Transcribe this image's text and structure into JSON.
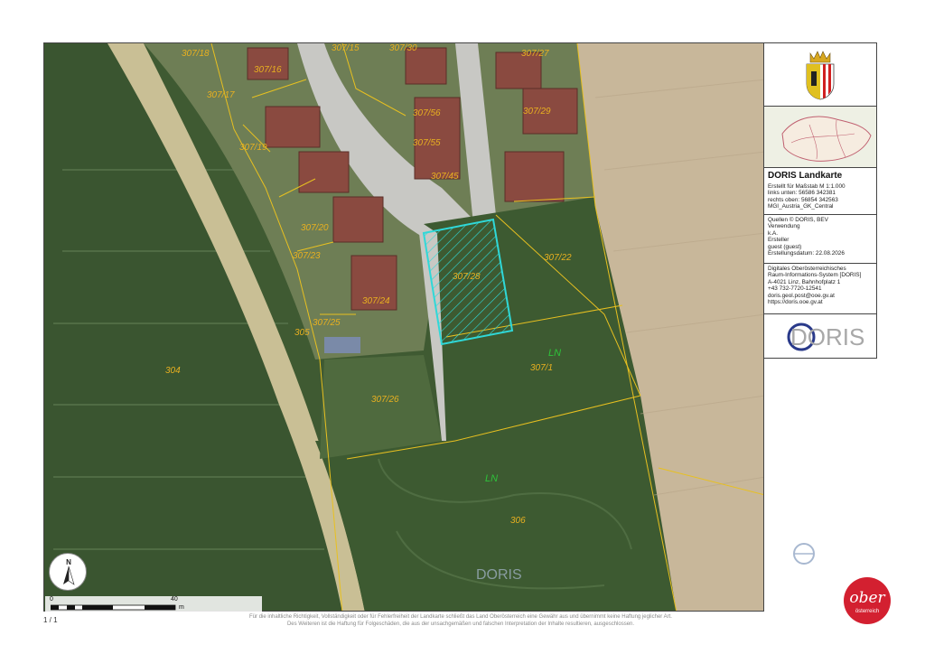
{
  "map": {
    "parcel_labels": [
      "307/18",
      "307/17",
      "307/16",
      "307/15",
      "307/56",
      "307/55",
      "307/45",
      "307/29",
      "307/19",
      "307/20",
      "307/23",
      "307/24",
      "307/25",
      "305",
      "307/28",
      "307/22",
      "307/1",
      "307/26",
      "304",
      "306",
      "307/30",
      "307/27"
    ],
    "usage_labels": [
      "LN",
      "LN"
    ],
    "watermark": "DORIS",
    "highlight_color": "#2fd8d8",
    "boundary_color": "#e8c020"
  },
  "north_arrow": {
    "label": "N"
  },
  "scale_bar": {
    "start": "0",
    "end": "40",
    "unit": "m"
  },
  "panel": {
    "title": "DORIS Landkarte",
    "scale_line": "Erstellt für Maßstab M 1:1.000",
    "coord_left": "links unten: 56586 342381",
    "coord_right": "rechts oben: 56854 342563",
    "crs": "MGI_Austria_GK_Central",
    "sources": "Quellen © DORIS, BEV",
    "usage_label": "Verwendung",
    "usage_value": "k.A.",
    "creator_label": "Ersteller",
    "creator_value": "guest (guest)",
    "created_date": "Erstellungsdatum: 22.08.2026",
    "org_line1": "Digitales Oberösterreichisches",
    "org_line2": "Raum-Informations-System [DORIS]",
    "address": "A-4021 Linz, Bahnhofplatz 1",
    "phone": "+43 732-7720-12541",
    "email": "doris.geol.post@ooe.gv.at",
    "web": "https://doris.ooe.gv.at",
    "logo_text": "DORIS"
  },
  "page_count": "1 / 1",
  "disclaimer_line1": "Für die inhaltliche Richtigkeit, Vollständigkeit oder für Fehlerfreiheit der Landkarte schließt das Land Oberösterreich eine Gewähr aus und übernimmt keine Haftung jeglicher Art.",
  "disclaimer_line2": "Des Weiteren ist die Haftung für Folgeschäden, die aus der unsachgemäßen und falschen Interpretation der Inhalte resultieren, ausgeschlossen.",
  "badge": {
    "text": "ober",
    "subtext": "österreich",
    "color": "#d32030"
  }
}
